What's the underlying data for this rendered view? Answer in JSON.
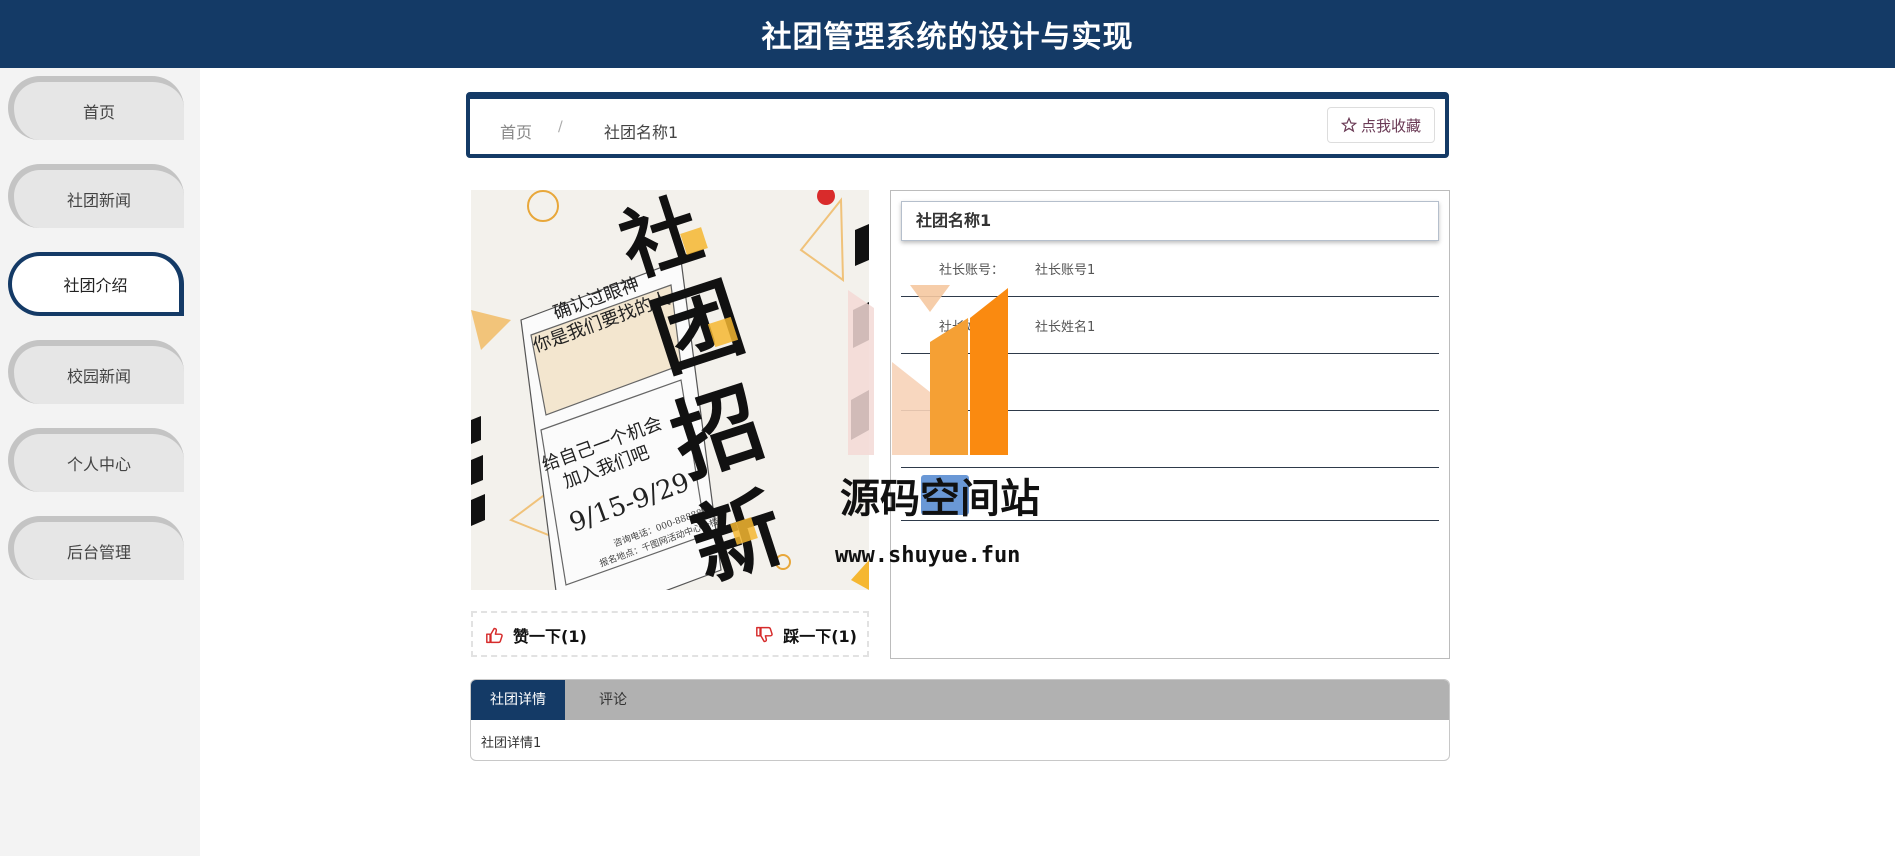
{
  "header": {
    "title": "社团管理系统的设计与实现",
    "bg_color": "#143a66"
  },
  "sidebar": {
    "items": [
      {
        "label": "首页"
      },
      {
        "label": "社团新闻"
      },
      {
        "label": "社团介绍"
      },
      {
        "label": "校园新闻"
      },
      {
        "label": "个人中心"
      },
      {
        "label": "后台管理"
      }
    ],
    "active_index": 2
  },
  "breadcrumb": {
    "home": "首页",
    "separator": "/",
    "current": "社团名称1"
  },
  "favorite": {
    "icon": "star-outline-icon",
    "label": "点我收藏"
  },
  "poster": {
    "big_text": [
      "社",
      "团",
      "招",
      "新"
    ],
    "line1": "确认过眼神",
    "line2": "你是我们要找的人",
    "card_line1": "给自己一个机会",
    "card_line2": "加入我们吧",
    "dates": "9/15-9/29",
    "contact": "咨询电话：000-8888888",
    "address": "报名地点：千图网活动中心一楼"
  },
  "votes": {
    "up": {
      "icon": "thumbs-up-icon",
      "label": "赞一下(1)"
    },
    "down": {
      "icon": "thumbs-down-icon",
      "label": "踩一下(1)"
    }
  },
  "info": {
    "title": "社团名称1",
    "rows": [
      {
        "label": "社长账号：",
        "value": "社长账号1"
      },
      {
        "label": "社长姓名：",
        "value": "社长姓名1"
      }
    ]
  },
  "watermark": {
    "text": "源码空间站",
    "url": "www.shuyue.fun"
  },
  "tabs": {
    "items": [
      {
        "label": "社团详情"
      },
      {
        "label": "评论"
      }
    ],
    "content": "社团详情1"
  }
}
